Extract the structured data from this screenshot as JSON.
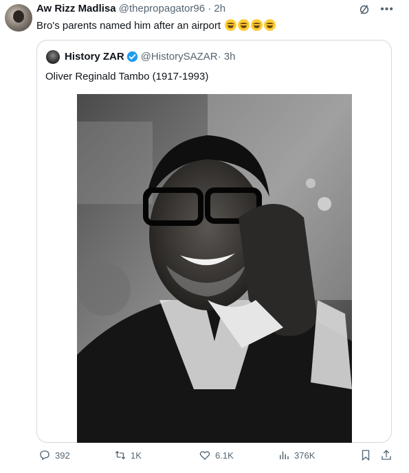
{
  "tweet": {
    "author_name": "Aw Rizz Madlisa",
    "author_handle": "@thepropagator96",
    "time": "· 2h",
    "text": "Bro's parents named him after an airport ",
    "emoji": [
      "joy-emoji",
      "joy-emoji",
      "joy-emoji",
      "joy-emoji"
    ]
  },
  "quote": {
    "author_name": "History ZAR",
    "author_handle": "@HistorySAZAR",
    "time": "· 3h",
    "text": "Oliver Reginald Tambo (1917-1993)"
  },
  "actions": {
    "replies": "392",
    "reposts": "1K",
    "likes": "6.1K",
    "views": "376K"
  },
  "colors": {
    "verified": "#1d9bf0",
    "muted": "#536471",
    "border": "#cfd9de"
  }
}
